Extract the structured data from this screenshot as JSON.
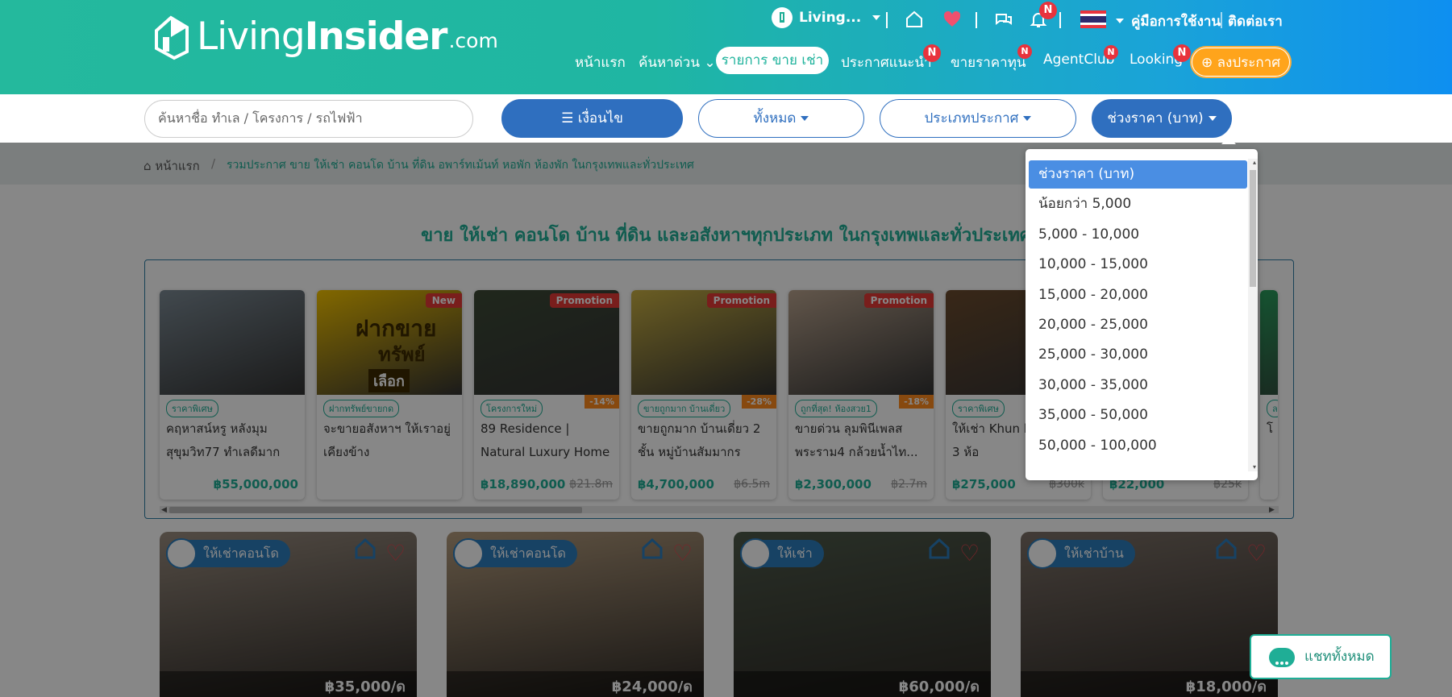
{
  "header": {
    "logo_word1": "Living",
    "logo_word2": "Insider",
    "logo_domain": ".com",
    "user_pill": "Living...",
    "guide_link": "คู่มือการใช้งาน",
    "contact_link": "ติดต่อเรา",
    "badge_letter": "N",
    "nav": {
      "home": "หน้าแรก",
      "quick_search": "ค้นหาด่วน",
      "listings_sale_rent": "รายการ ขาย เช่า",
      "recommended": "ประกาศแนะนำ",
      "sell_at_cost": "ขายราคาทุน",
      "agentclub": "AgentClub",
      "looking": "Looking",
      "post_button": "ลงประกาศ"
    }
  },
  "filters": {
    "search_placeholder": "ค้นหาชื่อ ทำเล / โครงการ / รถไฟฟ้า",
    "conditions": "เงื่อนไข",
    "all": "ทั้งหมด",
    "listing_type": "ประเภทประกาศ",
    "price_range": "ช่วงราคา (บาท)"
  },
  "breadcrumb": {
    "home": "หน้าแรก",
    "sep": "/",
    "current": "รวมประกาศ ขาย ให้เช่า คอนโด บ้าน ที่ดิน อพาร์ทเม้นท์ หอพัก ห้องพัก ในกรุงเทพและทั่วประเทศ"
  },
  "headline": "ขาย ให้เช่า คอนโด บ้าน ที่ดิน และอสังหาฯทุกประเภท ในกรุงเทพและทั่วประเทศ",
  "featured": [
    {
      "tag": "ราคาพิเศษ",
      "title": "คฤหาสน์หรู หลังมุม สุขุมวิท77 ทำเลดีมาก",
      "price": "฿55,000,000",
      "old_price": "",
      "discount": "",
      "label": "",
      "img_color": "#7c8a94"
    },
    {
      "tag": "ฝากทรัพย์ขายกด",
      "title": "จะขายอสังหาฯ ให้เราอยู่เคียงข้าง",
      "price": "",
      "old_price": "",
      "discount": "",
      "label": "New",
      "img_color": "#f5c400",
      "promo_big": "ฝากขาย",
      "promo_big2": "ทรัพย์",
      "promo_small": "เลือก"
    },
    {
      "tag": "โครงการใหม่",
      "title": "89 Residence | Natural Luxury Home on...",
      "price": "฿18,890,000",
      "old_price": "฿21.8m",
      "discount": "-14%",
      "label": "Promotion",
      "img_color": "#3d4a36"
    },
    {
      "tag": "ขายถูกมาก บ้านเดี่ยว",
      "title": "ขายถูกมาก บ้านเดี่ยว 2 ชั้น หมู่บ้านสัมมากร มีน...",
      "price": "฿4,700,000",
      "old_price": "฿6.5m",
      "discount": "-28%",
      "label": "Promotion",
      "img_color": "#c9b043"
    },
    {
      "tag": "ถูกที่สุด! ห้องสวย1",
      "title": "ขายด่วน ลุมพินีเพลส พระราม4 กล้วยน้ำไท...",
      "price": "฿2,300,000",
      "old_price": "฿2.7m",
      "discount": "-18%",
      "label": "Promotion",
      "img_color": "#b9a38e"
    },
    {
      "tag": "ราคาพิเศษ",
      "title": "ให้เช่า Khun b ทองหล่อ 3 ห้อ",
      "price": "฿275,000",
      "old_price": "฿300k",
      "discount": "",
      "label": "",
      "img_color": "#6b4b2e"
    },
    {
      "tag": "",
      "title": "",
      "price": "฿22,000",
      "old_price": "฿25k",
      "discount": "",
      "label": "",
      "img_color": "#8c8c8c"
    },
    {
      "tag": "ล",
      "title": "โ ย",
      "price": "",
      "old_price": "",
      "discount": "",
      "label": "",
      "img_color": "#2a9d5d"
    }
  ],
  "listings": [
    {
      "badge": "ให้เช่าคอนโด",
      "price": "฿35,000/ด",
      "img_color": "#9a8d80"
    },
    {
      "badge": "ให้เช่าคอนโด",
      "price": "฿24,000/ด",
      "img_color": "#b49c7e"
    },
    {
      "badge": "ให้เช่า",
      "price": "฿60,000/ด",
      "img_color": "#4e5a4a"
    },
    {
      "badge": "ให้เช่าบ้าน",
      "price": "฿18,000/ด",
      "img_color": "#7d7168"
    }
  ],
  "price_dropdown": {
    "options": [
      "ช่วงราคา (บาท)",
      "น้อยกว่า 5,000",
      "5,000 - 10,000",
      "10,000 - 15,000",
      "15,000 - 20,000",
      "20,000 - 25,000",
      "25,000 - 30,000",
      "30,000 - 35,000",
      "35,000 - 50,000",
      "50,000 - 100,000"
    ],
    "selected_index": 0
  },
  "chat_button": "แชททั้งหมด",
  "colors": {
    "brand_green": "#1fae96",
    "brand_blue": "#2f6fbf",
    "post_orange": "#ffa41b",
    "badge_red": "#e8333d"
  }
}
